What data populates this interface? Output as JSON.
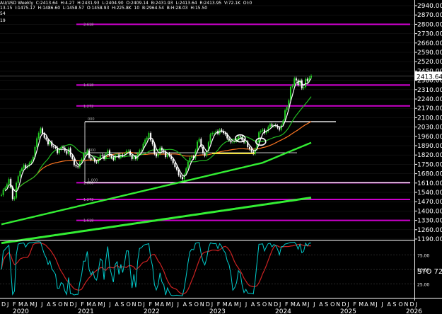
{
  "header": {
    "line1": "AU/USD Weekly  C:2413.64  H:4.27  H:2431.93  L:2404.90  O:2409.14  B:2431.93  L:2413.64  R:2413.95  V:72.1K  OI:0",
    "line2": "13-15  I:1475.17  H:1486.60  L:1458.57  O:1458.93  H:225.8K  10  B:2964.54  B:H:28.03  H:15.50",
    "line3": "54",
    "line4": "19"
  },
  "colors": {
    "background": "#000000",
    "grid": "#1c1c1c",
    "price": "#ffffff",
    "fib": "#cc00cc",
    "ma_fast": "#ffffff",
    "ma_mid": "#22bb22",
    "ma_slow": "#ff7722",
    "ma_long": "#33ee33",
    "candle_up": "#22cc22",
    "candle_down": "#ffffff",
    "stoch_k": "#00cccc",
    "stoch_d": "#cc2222",
    "highlight": "#ffee44",
    "current_price_box": "#ffffff"
  },
  "chart_data": {
    "type": "candlestick",
    "title": "AU/USD Weekly",
    "current_price": "2413.64",
    "ylim": [
      1190,
      2940
    ],
    "y_ticks": [
      "2940.00",
      "2870.00",
      "2800.00",
      "2730.00",
      "2660.00",
      "2590.00",
      "2520.00",
      "2450.00",
      "2380.00",
      "2310.00",
      "2240.00",
      "2170.00",
      "2100.00",
      "2030.00",
      "1960.00",
      "1890.00",
      "1820.00",
      "1750.00",
      "1680.00",
      "1610.00",
      "1540.00",
      "1470.00",
      "1400.00",
      "1330.00",
      "1260.00",
      "1190.00"
    ],
    "x_month_labels": [
      "D",
      "J",
      "F",
      "M",
      "A",
      "M",
      "J",
      "J",
      "A",
      "S",
      "O",
      "N",
      "D",
      "J",
      "F",
      "M",
      "A",
      "M",
      "J",
      "J",
      "A",
      "S",
      "O",
      "N",
      "D",
      "J",
      "F",
      "M",
      "A",
      "M",
      "J",
      "J",
      "A",
      "S",
      "O",
      "N",
      "D",
      "J",
      "F",
      "M",
      "A",
      "M",
      "J",
      "J",
      "A",
      "S",
      "O",
      "N",
      "D",
      "J",
      "F",
      "M",
      "A",
      "M",
      "J",
      "J",
      "A",
      "S",
      "O",
      "N",
      "D",
      "J",
      "F",
      "M",
      "A",
      "M",
      "J",
      "J",
      "A",
      "S",
      "O",
      "N",
      "D",
      "J"
    ],
    "x_year_labels": [
      "2020",
      "2021",
      "2022",
      "2023",
      "2024",
      "2025",
      "2026"
    ],
    "fib_levels": [
      {
        "label": "2.618",
        "value": 2800
      },
      {
        "label": "1.618",
        "value": 2345
      },
      {
        "label": "1.272",
        "value": 2188
      },
      {
        "label": "1.000",
        "value": 1612
      },
      {
        "label": "1.272",
        "value": 1487
      },
      {
        "label": "1.618",
        "value": 1330
      }
    ],
    "white_levels": [
      {
        "label": "000",
        "value": 2070
      },
      {
        "label": ".500",
        "value": 1837
      },
      {
        "label": "1.000",
        "value": 1612
      }
    ],
    "weekly_close": [
      1520,
      1560,
      1575,
      1600,
      1640,
      1580,
      1490,
      1500,
      1610,
      1660,
      1700,
      1720,
      1745,
      1725,
      1740,
      1760,
      1775,
      1805,
      1880,
      1945,
      1985,
      2020,
      1980,
      1950,
      1935,
      1900,
      1920,
      1885,
      1880,
      1875,
      1835,
      1860,
      1880,
      1875,
      1850,
      1830,
      1870,
      1815,
      1790,
      1745,
      1735,
      1730,
      1765,
      1790,
      1830,
      1830,
      1855,
      1800,
      1785,
      1795,
      1770,
      1765,
      1790,
      1820,
      1815,
      1790,
      1830,
      1855,
      1815,
      1800,
      1785,
      1820,
      1825,
      1800,
      1820,
      1815,
      1830,
      1850,
      1850,
      1820,
      1790,
      1810,
      1790,
      1830,
      1855,
      1860,
      1905,
      1935,
      1950,
      1985,
      1930,
      1900,
      1830,
      1810,
      1830,
      1875,
      1855,
      1845,
      1805,
      1830,
      1815,
      1790,
      1760,
      1730,
      1710,
      1670,
      1655,
      1640,
      1675,
      1720,
      1770,
      1800,
      1810,
      1795,
      1855,
      1920,
      1940,
      1880,
      1835,
      1815,
      1850,
      1915,
      1975,
      1985,
      1985,
      2000,
      1980,
      2010,
      2000,
      1985,
      1975,
      1945,
      1930,
      1915,
      1920,
      1925,
      1935,
      1960,
      1955,
      1930,
      1915,
      1920,
      1880,
      1865,
      1845,
      1830,
      1865,
      1915,
      1990,
      2000,
      2010,
      1985,
      2000,
      2030,
      2050,
      2035,
      2045,
      2040,
      2025,
      2010,
      2045,
      2080,
      2155,
      2180,
      2230,
      2330,
      2340,
      2395,
      2380,
      2345,
      2380,
      2320,
      2330,
      2390,
      2375,
      2400,
      2413
    ],
    "highlights": [
      {
        "label": "circle-1",
        "date_index": 128,
        "value": 1945
      },
      {
        "label": "circle-2",
        "date_index": 139,
        "value": 1920
      }
    ],
    "stochastic": {
      "levels": [
        "75.00",
        "50.00",
        "25.00"
      ],
      "label": "STO",
      "value": "72"
    }
  }
}
